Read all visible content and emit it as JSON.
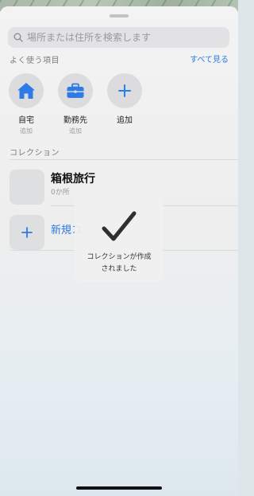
{
  "search": {
    "placeholder": "場所または住所を検索します"
  },
  "favorites": {
    "section_label": "よく使う項目",
    "see_all_label": "すべて見る",
    "items": [
      {
        "title": "自宅",
        "subtitle": "追加",
        "icon": "home-icon"
      },
      {
        "title": "勤務先",
        "subtitle": "追加",
        "icon": "briefcase-icon"
      },
      {
        "title": "追加",
        "subtitle": "",
        "icon": "plus-icon"
      }
    ]
  },
  "collections": {
    "section_label": "コレクション",
    "items": [
      {
        "title": "箱根旅行",
        "subtitle": "0か所"
      }
    ],
    "new_label": "新規コ"
  },
  "toast": {
    "line1": "コレクションが作成",
    "line2": "されました",
    "icon": "checkmark-icon"
  },
  "colors": {
    "accent": "#2d7be5"
  }
}
